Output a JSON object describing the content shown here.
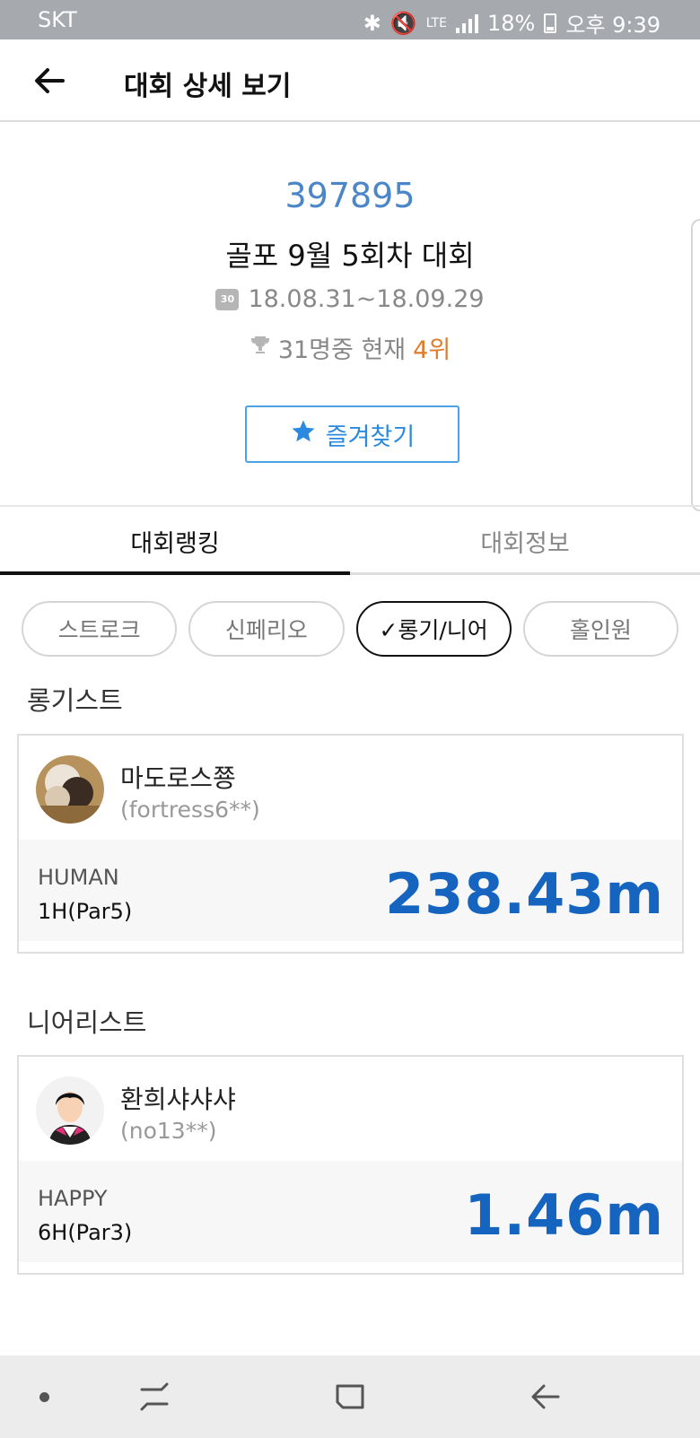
{
  "status_bar": {
    "carrier": "SKT",
    "battery": "18%",
    "time": "오후 9:39",
    "network": "LTE"
  },
  "header": {
    "title": "대회 상세 보기"
  },
  "competition": {
    "code": "397895",
    "title": "골포 9월 5회차 대회",
    "calendar_icon_text": "30",
    "period": "18.08.31~18.09.29",
    "rank_prefix": "31명중 현재",
    "rank": "4위",
    "favorite_label": "즐겨찾기"
  },
  "tabs": [
    {
      "label": "대회랭킹",
      "active": true
    },
    {
      "label": "대회정보",
      "active": false
    }
  ],
  "filters": [
    {
      "label": "스트로크",
      "selected": false
    },
    {
      "label": "신페리오",
      "selected": false
    },
    {
      "label": "✓롱기/니어",
      "selected": true
    },
    {
      "label": "홀인원",
      "selected": false
    }
  ],
  "sections": [
    {
      "heading": "롱기스트",
      "player": {
        "nickname": "마도로스쭁",
        "user_id": "(fortress6**)"
      },
      "club": "HUMAN",
      "hole": "1H(Par5)",
      "distance": "238.43m"
    },
    {
      "heading": "니어리스트",
      "player": {
        "nickname": "환희샤샤샤",
        "user_id": "(no13**)"
      },
      "club": "HAPPY",
      "hole": "6H(Par3)",
      "distance": "1.46m"
    }
  ],
  "colors": {
    "accent_blue": "#4a86c8",
    "rank_orange": "#e07b2a",
    "distance_blue": "#1565c0",
    "favorite_blue": "#2b8ae0"
  }
}
